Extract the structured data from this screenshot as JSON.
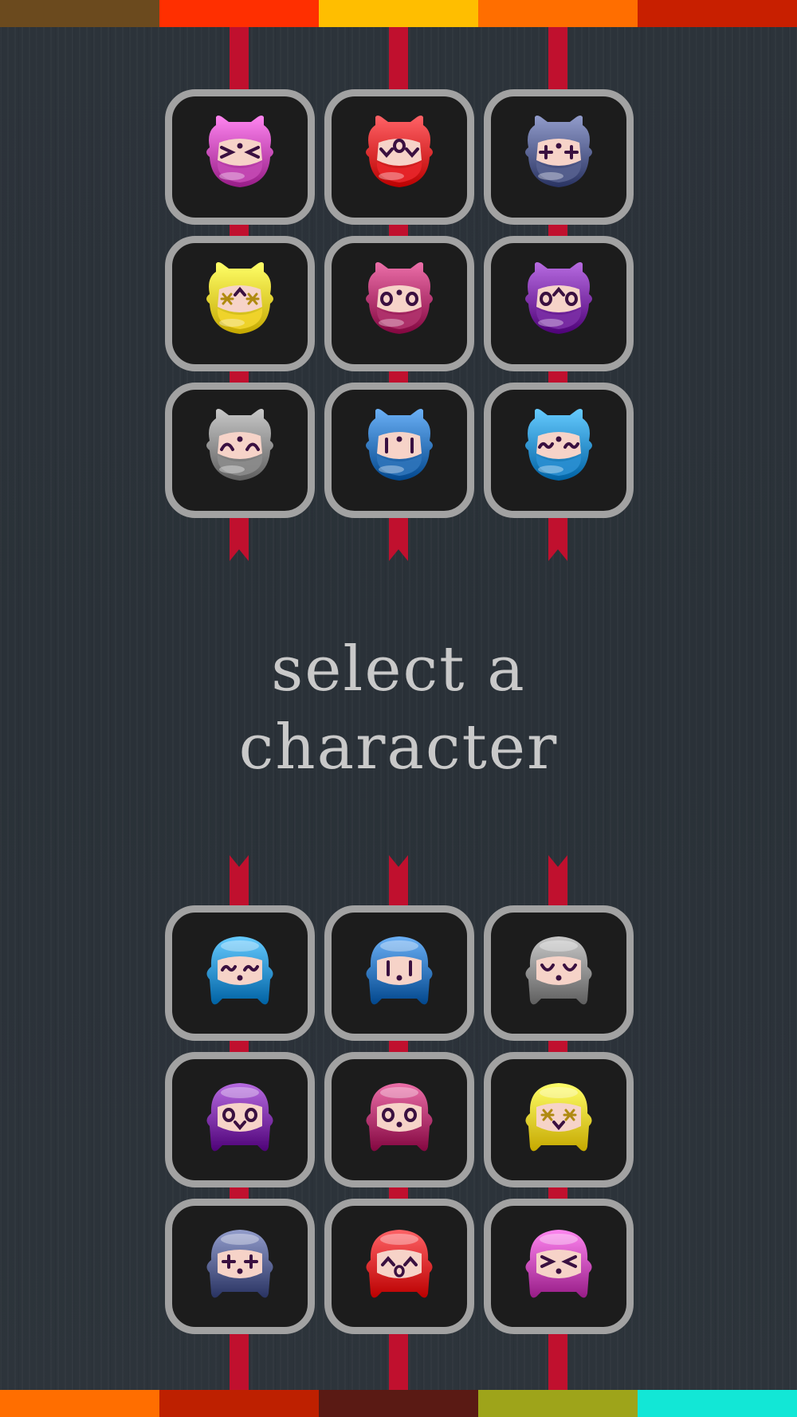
{
  "title": {
    "line1": "select a",
    "line2": "character"
  },
  "colors": {
    "top_stripes": [
      "#6b4a1e",
      "#ff2f00",
      "#ffbe00",
      "#ff6e00",
      "#c81f00"
    ],
    "bottom_stripes": [
      "#ff6e00",
      "#be2000",
      "#5a1a14",
      "#9ea41a",
      "#12e7d6"
    ],
    "ribbon": "#c0102e",
    "tile_border": "#a2a2a2",
    "tile_fill": "#1c1c1c"
  },
  "characters": [
    {
      "group": "top",
      "color": "#c449b4",
      "face": "&gt; &lt;"
    },
    {
      "group": "top",
      "color": "#e8262a",
      "face": "v O v"
    },
    {
      "group": "top",
      "color": "#56608f",
      "face": "+ +"
    },
    {
      "group": "top",
      "color": "#f2d52c",
      "face": "* ^ *"
    },
    {
      "group": "top",
      "color": "#b0336d",
      "face": "O O"
    },
    {
      "group": "top",
      "color": "#7b2fa5",
      "face": "O ^ O"
    },
    {
      "group": "top",
      "color": "#8c8c8c",
      "face": "n n"
    },
    {
      "group": "top",
      "color": "#2f74ba",
      "face": "| |"
    },
    {
      "group": "top",
      "color": "#2a8fd1",
      "face": "~ ~"
    },
    {
      "group": "bottom",
      "color": "#2a8fd1",
      "face": "~ ~"
    },
    {
      "group": "bottom",
      "color": "#2f74ba",
      "face": "| |"
    },
    {
      "group": "bottom",
      "color": "#8c8c8c",
      "face": "u u"
    },
    {
      "group": "bottom",
      "color": "#7b2fa5",
      "face": "O v O"
    },
    {
      "group": "bottom",
      "color": "#b0336d",
      "face": "O O"
    },
    {
      "group": "bottom",
      "color": "#f2d52c",
      "face": "* v *"
    },
    {
      "group": "bottom",
      "color": "#56608f",
      "face": "+ . +"
    },
    {
      "group": "bottom",
      "color": "#e8262a",
      "face": "^ o ^"
    },
    {
      "group": "bottom",
      "color": "#c449b4",
      "face": "&gt; &lt;"
    }
  ]
}
